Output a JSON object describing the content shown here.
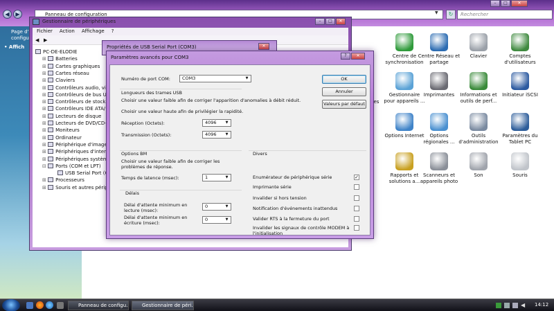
{
  "control_panel": {
    "address": "Panneau de configuration",
    "search_placeholder": "Rechercher",
    "sidebar": [
      "Page d'",
      "configu",
      "Affich"
    ],
    "items": [
      {
        "label": "Centre de synchronisation",
        "icon": "sync-center-icon",
        "color": "#2e9a3a"
      },
      {
        "label": "Centre Réseau et partage",
        "icon": "network-center-icon",
        "color": "#2c6cb2"
      },
      {
        "label": "Clavier",
        "icon": "keyboard-icon",
        "color": "#9aa0a8"
      },
      {
        "label": "Comptes d'utilisateurs",
        "icon": "user-accounts-icon",
        "color": "#3f8a3f"
      },
      {
        "label": "Gestionnaire pour appareils ...",
        "icon": "device-manager-icon",
        "color": "#5aa2d6"
      },
      {
        "label": "Imprimantes",
        "icon": "printer-icon",
        "color": "#6a6a72"
      },
      {
        "label": "Informations et outils de perf...",
        "icon": "performance-icon",
        "color": "#3a8a3a"
      },
      {
        "label": "Initiateur iSCSI",
        "icon": "iscsi-icon",
        "color": "#2c5aa0"
      },
      {
        "label": "Options Internet",
        "icon": "internet-options-icon",
        "color": "#3f83c8"
      },
      {
        "label": "Options régionales ...",
        "icon": "regional-options-icon",
        "color": "#4a90d0"
      },
      {
        "label": "Outils d'administration",
        "icon": "admin-tools-icon",
        "color": "#7a8aa0"
      },
      {
        "label": "Paramètres du Tablet PC",
        "icon": "tablet-pc-icon",
        "color": "#2d5d9a"
      },
      {
        "label": "Rapports et solutions a...",
        "icon": "reports-icon",
        "color": "#c8a020"
      },
      {
        "label": "Scanneurs et appareils photo",
        "icon": "scanner-icon",
        "color": "#8a8f98"
      },
      {
        "label": "Son",
        "icon": "sound-icon",
        "color": "#a0a4ac"
      },
      {
        "label": "Souris",
        "icon": "mouse-icon",
        "color": "#c0c4ca"
      }
    ],
    "partial_labels": [
      "ques"
    ]
  },
  "device_manager": {
    "title": "Gestionnaire de périphériques",
    "menu": [
      "Fichier",
      "Action",
      "Affichage",
      "?"
    ],
    "tree": [
      "PC-DE-ELODIE",
      "Batteries",
      "Cartes graphiques",
      "Cartes réseau",
      "Claviers",
      "Contrôleurs audio, vid",
      "Contrôleurs de bus US",
      "Contrôleurs de stocka",
      "Contrôleurs IDE ATA/",
      "Lecteurs de disque",
      "Lecteurs de DVD/CD-",
      "Moniteurs",
      "Ordinateur",
      "Périphérique d'image",
      "Périphériques d'inter",
      "Périphériques systèm",
      "Ports (COM et LPT)",
      "USB Serial Port (C",
      "Processeurs",
      "Souris et autres périph"
    ]
  },
  "props_dialog": {
    "title": "Propriétés de USB Serial Port (COM3)"
  },
  "adv_dialog": {
    "title": "Paramètres avancés pour COM3",
    "com_port_label": "Numéro de port COM:",
    "com_port_value": "COM3",
    "usb_section": "Longueurs des trames USB",
    "usb_desc1": "Choisir une valeur faible afin de corriger  l'apparition d'anomalies à débit réduit.",
    "usb_desc2": "Choisir une valeur haute afin de privilégier la rapidité.",
    "rx_label": "Réception (Octets):",
    "rx_value": "4096",
    "tx_label": "Transmission (Octets):",
    "tx_value": "4096",
    "bm_section": "Options BM",
    "bm_desc": "Choisir une valeur faible afin de corriger les problèmes de réponse.",
    "latency_label": "Temps de latence (msec):",
    "latency_value": "1",
    "delays_section": "Délais",
    "read_timeout_label": "Délai d'attente minimum en lecture (msec):",
    "read_timeout_value": "0",
    "write_timeout_label": "Délai d'attente minimum en écriture (msec):",
    "write_timeout_value": "0",
    "misc_section": "Divers",
    "options": [
      {
        "label": "Enumérateur de périphérique série",
        "checked": true
      },
      {
        "label": "Imprimante série",
        "checked": false
      },
      {
        "label": "Invalider si hors tension",
        "checked": false
      },
      {
        "label": "Notification d'événements inattendus",
        "checked": false
      },
      {
        "label": "Valider RTS à la fermeture du port",
        "checked": false
      },
      {
        "label": "Invalider les signaux de contrôle MODEM à l'initialisation",
        "checked": false
      }
    ],
    "ok": "OK",
    "cancel": "Annuler",
    "defaults": "Valeurs par défaut"
  },
  "taskbar": {
    "tasks": [
      "Panneau de configu...",
      "Gestionnaire de péri..."
    ],
    "time": "14:12"
  }
}
